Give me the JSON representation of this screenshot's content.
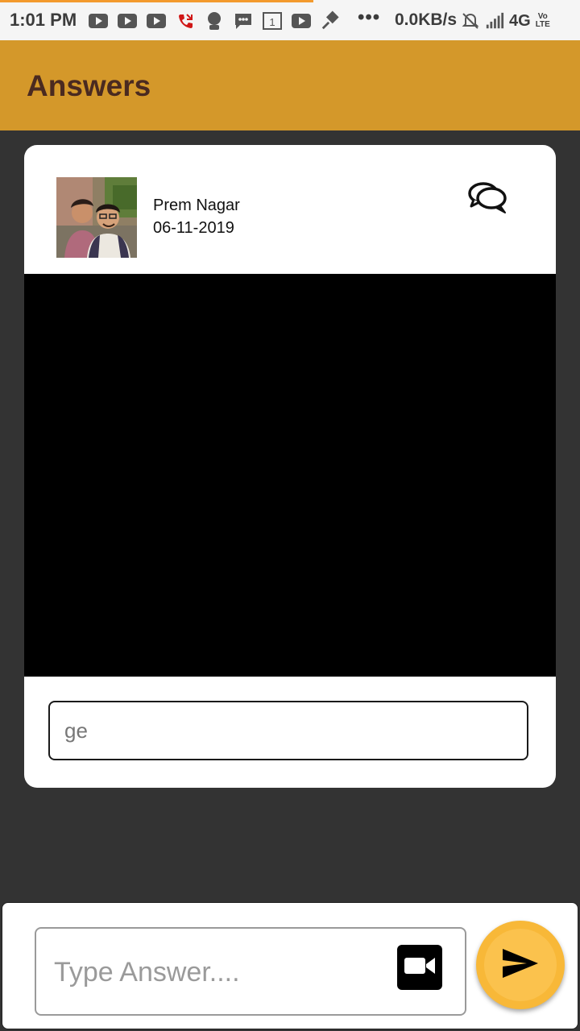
{
  "status_bar": {
    "time": "1:01 PM",
    "speed": "0.0KB/s",
    "network": "4G",
    "volte_top": "Vo",
    "volte_bottom": "LTE",
    "more": "•••",
    "calendar_day": "1",
    "progress_fraction": 0.54,
    "icons_left": [
      "youtube-icon",
      "youtube-icon",
      "youtube-icon",
      "missed-call-icon",
      "app-notification-icon",
      "message-icon",
      "calendar-icon",
      "youtube-icon",
      "pin-icon"
    ],
    "icons_right": [
      "silent-icon",
      "signal-icon"
    ]
  },
  "app_bar": {
    "title": "Answers"
  },
  "card": {
    "user_name": "Prem Nagar",
    "date": "06-11-2019",
    "answer_text": "ge"
  },
  "bottom_bar": {
    "input_placeholder": "Type Answer....",
    "input_value": ""
  },
  "colors": {
    "app_bar": "#d4982a",
    "title": "#4a2a20",
    "background": "#333333",
    "send_button": "#f8b838",
    "progress": "#f39a2e"
  }
}
